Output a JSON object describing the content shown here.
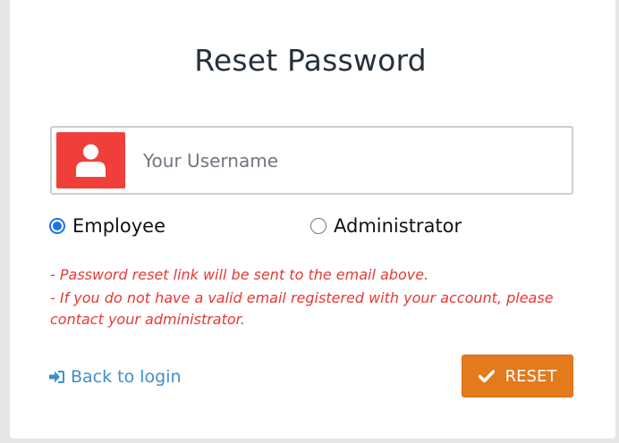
{
  "page": {
    "title": "Reset Password"
  },
  "username": {
    "placeholder": "Your Username",
    "value": "",
    "icon": "user-icon"
  },
  "role": {
    "options": [
      {
        "label": "Employee",
        "checked": true
      },
      {
        "label": "Administrator",
        "checked": false
      }
    ]
  },
  "notes": {
    "line1": "-  Password reset link will be sent to the email above.",
    "line2": "-  If you do not have a valid email registered with your account, please contact your administrator."
  },
  "actions": {
    "back_label": "Back to login",
    "back_icon": "sign-in-icon",
    "reset_label": "RESET",
    "reset_icon": "check-icon"
  },
  "colors": {
    "accent_red": "#f03f3a",
    "reset_orange": "#e37a1c",
    "link_blue": "#3f8fcb",
    "note_red": "#e53935"
  }
}
